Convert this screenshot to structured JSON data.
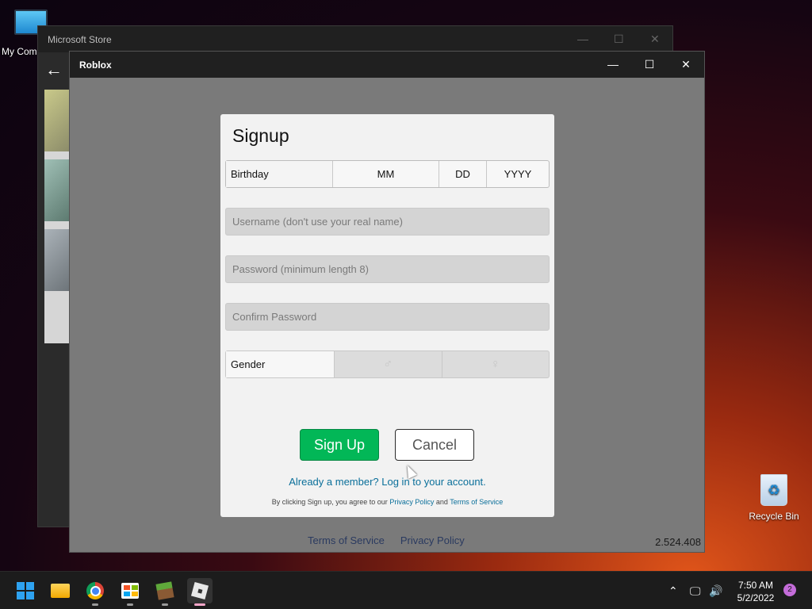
{
  "desktop": {
    "my_computer_label": "My Com",
    "recycle_bin_label": "Recycle Bin"
  },
  "store_window": {
    "title": "Microsoft Store"
  },
  "roblox_window": {
    "title": "Roblox",
    "footer": {
      "terms": "Terms of Service",
      "privacy": "Privacy Policy"
    },
    "version": "2.524.408"
  },
  "signup": {
    "title": "Signup",
    "birthday": {
      "label": "Birthday",
      "month": "MM",
      "day": "DD",
      "year": "YYYY"
    },
    "username_placeholder": "Username (don't use your real name)",
    "password_placeholder": "Password (minimum length 8)",
    "confirm_placeholder": "Confirm Password",
    "gender_label": "Gender",
    "signup_button": "Sign Up",
    "cancel_button": "Cancel",
    "member_link": "Already a member? Log in to your account.",
    "legal_prefix": "By clicking Sign up, you agree to our",
    "legal_privacy": "Privacy Policy",
    "legal_and": "and",
    "legal_terms": "Terms of Service"
  },
  "taskbar": {
    "time": "7:50 AM",
    "date": "5/2/2022",
    "notification_count": "2"
  },
  "colors": {
    "signup_green": "#02b757",
    "link_blue": "#0a6f9a",
    "taskbar": "#1c1c1c"
  }
}
